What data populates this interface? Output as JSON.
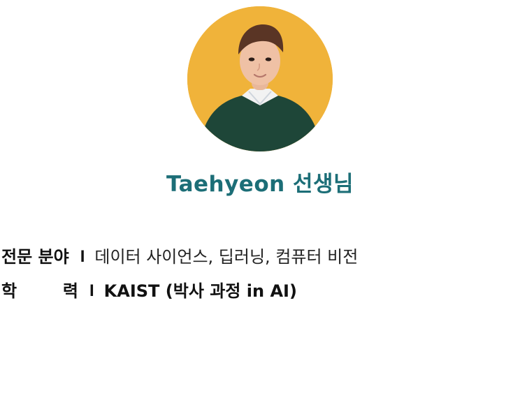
{
  "profile": {
    "name": "Taehyeon 선생님",
    "avatar_alt": "teacher-portrait",
    "colors": {
      "avatar_background": "#f0b33a",
      "name_text": "#1c6e77",
      "sweater": "#1e4638"
    }
  },
  "details": {
    "specialty": {
      "label": "전문 분야",
      "separator": "I",
      "value": "데이터 사이언스, 딥러닝, 컴퓨터 비전"
    },
    "education": {
      "label_first": "학",
      "label_last": "력",
      "separator": "I",
      "value": "KAIST (박사 과정 in AI)"
    }
  }
}
